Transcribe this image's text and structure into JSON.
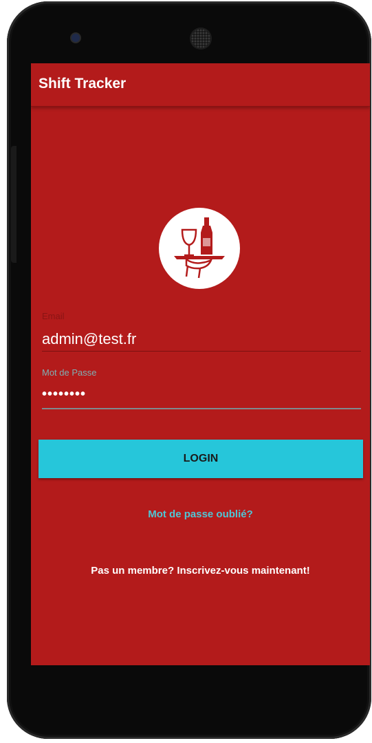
{
  "app": {
    "title": "Shift Tracker"
  },
  "login_form": {
    "email_label": "Email",
    "email_value": "admin@test.fr",
    "password_label": "Mot de Passe",
    "password_value": "••••••••",
    "login_button": "LOGIN",
    "forgot_password_link": "Mot de passe oublié?",
    "signup_link": "Pas un membre? Inscrivez-vous maintenant!"
  },
  "logo": {
    "icon": "waiter-tray-wine-icon"
  },
  "colors": {
    "background": "#b31b1b",
    "accent_button": "#26c6da",
    "link": "#4fc6d6",
    "phone_frame": "#0a0a0a"
  }
}
